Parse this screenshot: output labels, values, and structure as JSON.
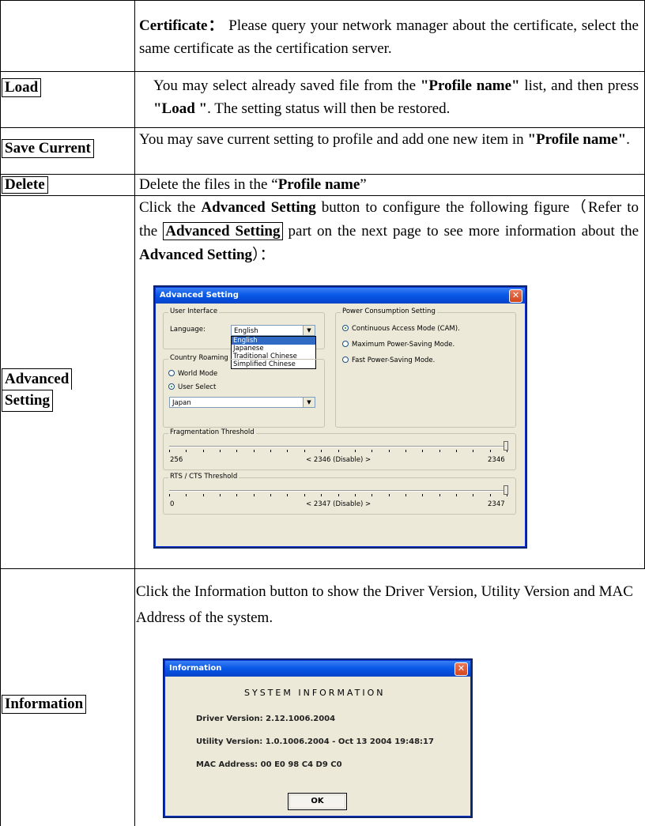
{
  "rows": {
    "certificate": {
      "term": "Certificate：",
      "text": "Please query your network manager about the certificate, select the same certificate as the certification server."
    },
    "load": {
      "label": "Load",
      "text_a": "You may select already saved file from the ",
      "bold_a": "\"Profile name\"",
      "text_b": " list, and then press ",
      "bold_b": "\"Load \"",
      "text_c": ". The setting status will then be restored."
    },
    "save_current": {
      "label": "Save Current",
      "text_a": "You may save current setting to profile and add one new item in ",
      "bold_a": "\"Profile name\"",
      "text_b": "."
    },
    "delete": {
      "label": "Delete",
      "text_a": "Delete the files in the “",
      "bold_a": "Profile name",
      "text_b": "”"
    },
    "advanced": {
      "label_line1": "Advanced",
      "label_line2": "Setting",
      "text_a": "Click the ",
      "bold_a": "Advanced Setting",
      "text_b": " button to configure the following figure（Refer to the ",
      "boxed": "Advanced Setting",
      "text_c": " part on the next page to see more information about the ",
      "bold_b": "Advanced Setting",
      "text_d": "）："
    },
    "information": {
      "label": "Information",
      "text": "Click the Information button to show the Driver Version, Utility Version and MAC Address of the system."
    }
  },
  "advanced_window": {
    "title": "Advanced Setting",
    "close_glyph": "✕",
    "user_interface": {
      "title": "User Interface",
      "language_label": "Language:",
      "language_value": "English",
      "options": [
        "English",
        "Japanese",
        "Traditional Chinese",
        "Simplified Chinese"
      ],
      "selected_index": 0
    },
    "country_roaming": {
      "title": "Country Roaming",
      "world_mode": "World Mode",
      "user_select": "User Select",
      "selected": "User Select",
      "country_value": "Japan"
    },
    "power": {
      "title": "Power Consumption Setting",
      "options": [
        "Continuous Access Mode (CAM).",
        "Maximum Power-Saving Mode.",
        "Fast Power-Saving Mode."
      ],
      "selected_index": 0
    },
    "fragmentation": {
      "title": "Fragmentation Threshold",
      "min": "256",
      "current": "< 2346 (Disable) >",
      "max": "2346",
      "level": 1.0
    },
    "rts": {
      "title": "RTS / CTS Threshold",
      "min": "0",
      "current": "< 2347 (Disable) >",
      "max": "2347",
      "level": 1.0
    }
  },
  "info_window": {
    "title": "Information",
    "close_glyph": "✕",
    "heading": "SYSTEM INFORMATION",
    "driver_label": "Driver Version:",
    "driver_value": "2.12.1006.2004",
    "utility_label": "Utility Version:",
    "utility_value": "1.0.1006.2004 - Oct 13 2004 19:48:17",
    "mac_label": "MAC Address:",
    "mac_value": "00 E0 98 C4 D9 C0",
    "ok_label": "OK"
  }
}
